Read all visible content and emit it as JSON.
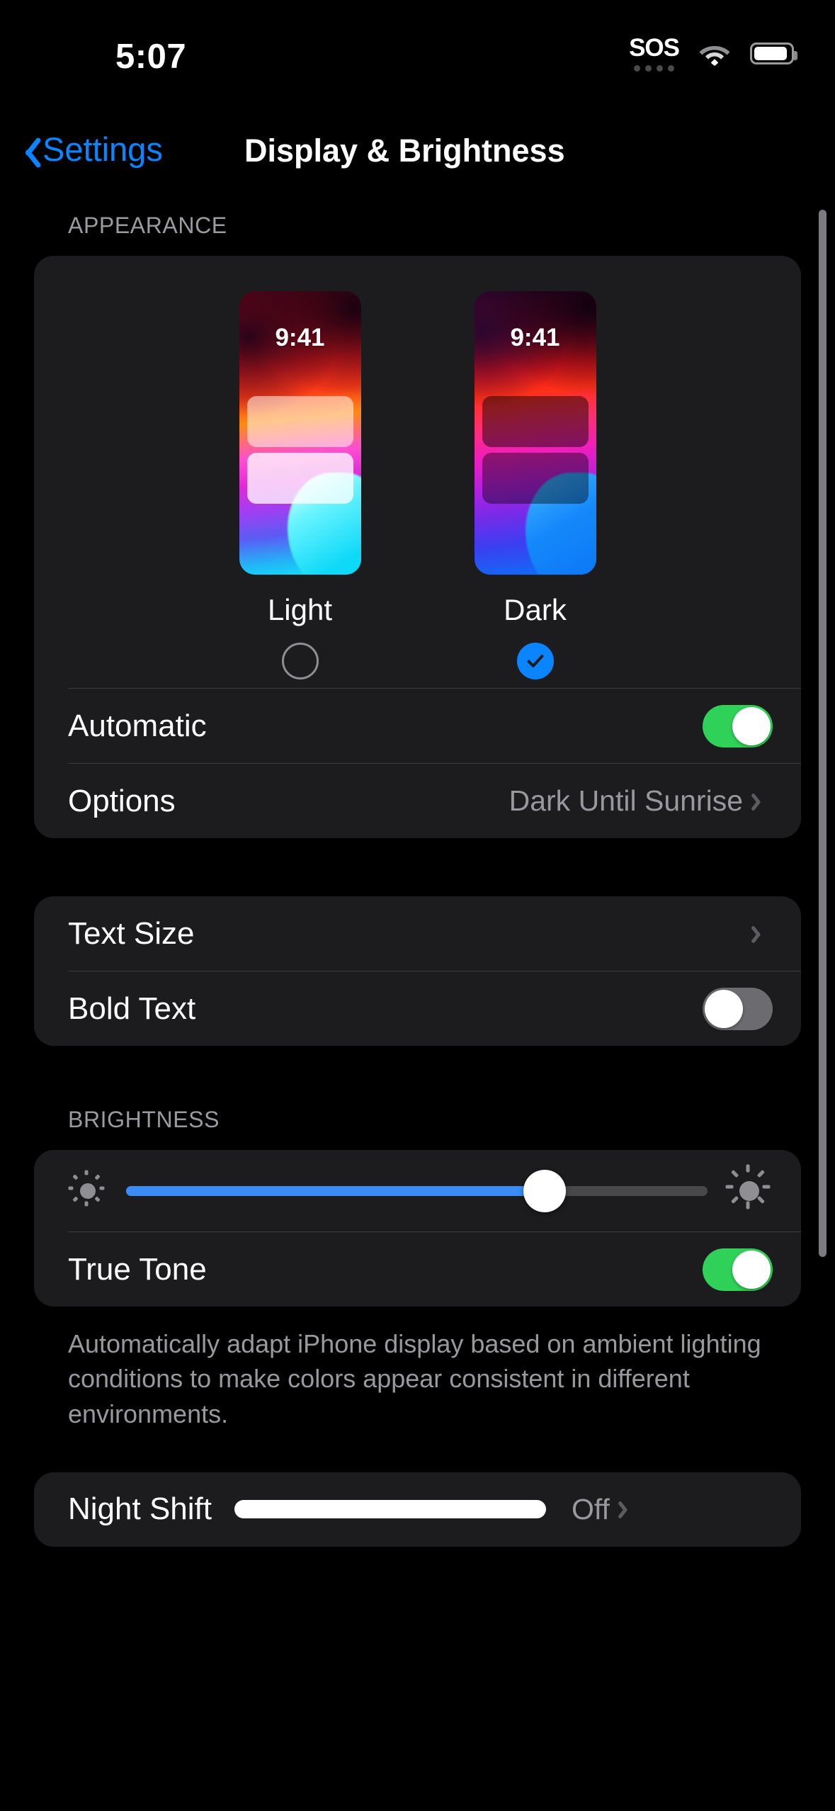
{
  "status_bar": {
    "time": "5:07",
    "sos_label": "SOS",
    "sos_dot_count": 4,
    "wifi_icon": "wifi-icon",
    "battery_icon": "battery-icon",
    "battery_level_percent": 82
  },
  "nav": {
    "back_label": "Settings",
    "back_icon": "chevron-left-icon",
    "title": "Display & Brightness"
  },
  "appearance": {
    "header": "APPEARANCE",
    "modes": [
      {
        "label": "Light",
        "preview_time": "9:41",
        "selected": false
      },
      {
        "label": "Dark",
        "preview_time": "9:41",
        "selected": true
      }
    ],
    "automatic": {
      "label": "Automatic",
      "toggle_state": "on"
    },
    "options": {
      "label": "Options",
      "value": "Dark Until Sunrise",
      "chevron_icon": "chevron-right-icon"
    }
  },
  "text_group": {
    "text_size": {
      "label": "Text Size",
      "chevron_icon": "chevron-right-icon"
    },
    "bold_text": {
      "label": "Bold Text",
      "toggle_state": "off"
    }
  },
  "brightness": {
    "header": "BRIGHTNESS",
    "slider": {
      "value_percent": 72,
      "min_icon": "sun-small-icon",
      "max_icon": "sun-large-icon"
    },
    "true_tone": {
      "label": "True Tone",
      "toggle_state": "on"
    },
    "footnote": "Automatically adapt iPhone display based on ambient lighting conditions to make colors appear consistent in different environments."
  },
  "night_shift": {
    "label": "Night Shift",
    "value": "Off",
    "chevron_icon": "chevron-right-icon"
  },
  "colors": {
    "accent_blue": "#0a84ff",
    "toggle_on_green": "#30d158",
    "toggle_off_gray": "#6b6b70",
    "card_background": "#1c1c1e",
    "page_background": "#000000",
    "secondary_text": "#98989d"
  }
}
